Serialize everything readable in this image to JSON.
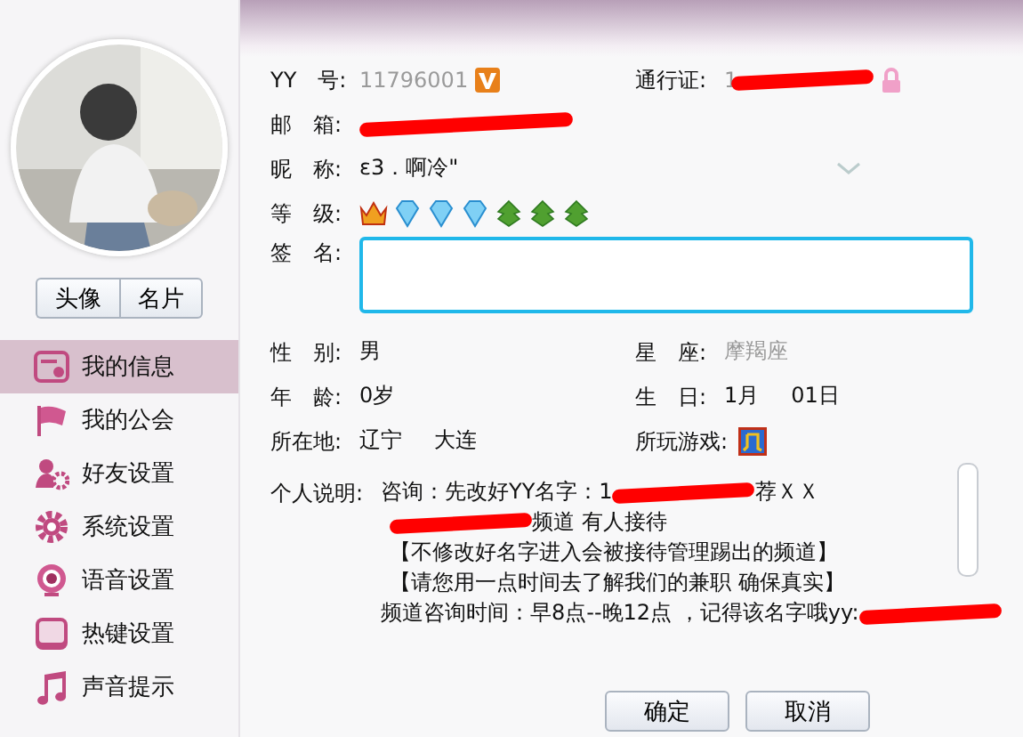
{
  "sidebar": {
    "avatar_tabs": [
      {
        "label": "头像"
      },
      {
        "label": "名片"
      }
    ],
    "items": [
      {
        "label": "我的信息",
        "kind": "card",
        "selected": true
      },
      {
        "label": "我的公会",
        "kind": "flag",
        "selected": false
      },
      {
        "label": "好友设置",
        "kind": "friends",
        "selected": false
      },
      {
        "label": "系统设置",
        "kind": "gear",
        "selected": false
      },
      {
        "label": "语音设置",
        "kind": "webcam",
        "selected": false
      },
      {
        "label": "热键设置",
        "kind": "square",
        "selected": false
      },
      {
        "label": "声音提示",
        "kind": "note",
        "selected": false
      }
    ]
  },
  "profile": {
    "yy_number": {
      "label": "YY　号:",
      "value": "11796001"
    },
    "passport": {
      "label": "通行证:",
      "value": "1",
      "redacted": true
    },
    "email": {
      "label": "邮　箱:",
      "redacted": true
    },
    "nickname": {
      "label": "昵　称:",
      "value": "ε3．啊冷\""
    },
    "level": {
      "label": "等　级:",
      "badges": [
        {
          "kind": "crown"
        },
        {
          "kind": "diamond"
        },
        {
          "kind": "diamond"
        },
        {
          "kind": "diamond"
        },
        {
          "kind": "leaf"
        },
        {
          "kind": "leaf"
        },
        {
          "kind": "leaf"
        }
      ]
    },
    "signature": {
      "label": "签　名:"
    },
    "gender": {
      "label": "性　别:",
      "value": "男"
    },
    "zodiac": {
      "label": "星　座:",
      "value": "摩羯座"
    },
    "age": {
      "label": "年　龄:",
      "value": "0岁"
    },
    "birthday": {
      "label": "生　日:",
      "month": "1月",
      "day": "01日"
    },
    "location": {
      "label": "所在地:",
      "province": "辽宁",
      "city": "大连"
    },
    "games": {
      "label": "所玩游戏:"
    },
    "description": {
      "label": "个人说明:",
      "lines": [
        {
          "before": "咨询：先改好YY名字：1",
          "redacted": true,
          "after": "荐ＸＸ"
        },
        {
          "redacted": true,
          "after": "频道 有人接待"
        },
        {
          "before": "【不修改好名字进入会被接待管理踢出的频道】",
          "redacted": false
        },
        {
          "before": "【请您用一点时间去了解我们的兼职 确保真实】",
          "redacted": false
        },
        {
          "before": "频道咨询时间：早8点--晚12点 ，记得该名字哦yy:",
          "redacted": true
        }
      ]
    }
  },
  "buttons": [
    "确定",
    "取消"
  ]
}
